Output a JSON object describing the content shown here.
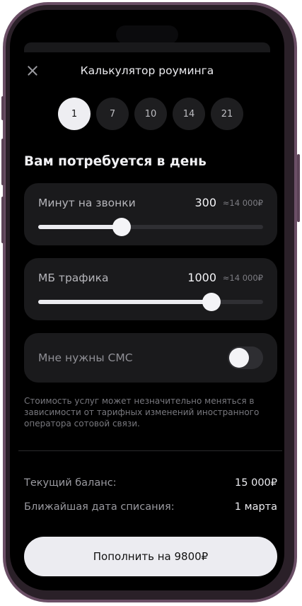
{
  "header": {
    "title": "Калькулятор роуминга",
    "close_icon": "close-icon"
  },
  "days": {
    "options": [
      "1",
      "7",
      "10",
      "14",
      "21"
    ],
    "selected": "1"
  },
  "section_title": "Вам потребуется в день",
  "minutes": {
    "label": "Минут на звонки",
    "value": "300",
    "approx": "≈14 000₽",
    "level_percent": 37
  },
  "traffic": {
    "label": "МБ трафика",
    "value": "1000",
    "approx": "≈14 000₽",
    "level_percent": 77
  },
  "sms": {
    "label": "Мне нужны СМС",
    "enabled": false
  },
  "note": "Стоимость услуг может незначительно меняться в зависимости от тарифных изменений иностранного оператора сотовой связи.",
  "summary": {
    "balance_label": "Текущий баланс:",
    "balance_value": "15 000₽",
    "charge_label": "Ближайшая дата списания:",
    "charge_value": "1 марта"
  },
  "cta_label": "Пополнить на 9800₽",
  "colors": {
    "background": "#000000",
    "card": "#1a1a1c",
    "accent": "#ececf0",
    "frame": "#6b4f66"
  }
}
